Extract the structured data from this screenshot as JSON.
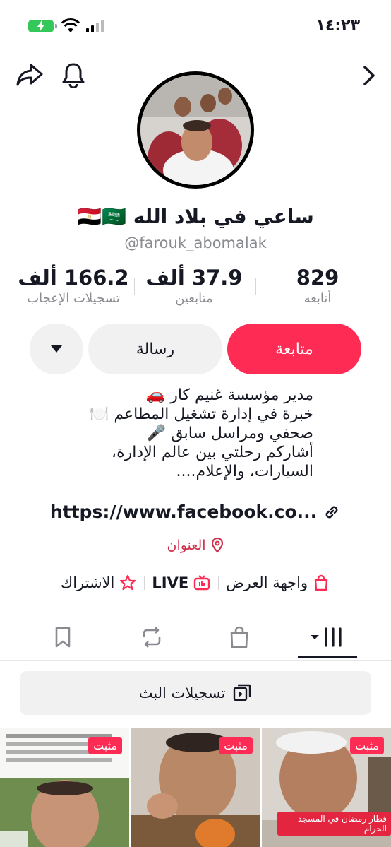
{
  "status": {
    "time": "١٤:٢٣"
  },
  "profile": {
    "name": "ساعي في بلاد الله 🇪🇬🇸🇦",
    "handle": "@farouk_abomalak"
  },
  "stats": [
    {
      "value": "829",
      "label": "أتابعه"
    },
    {
      "value": "37.9 ألف",
      "label": "متابعين"
    },
    {
      "value": "166.2 ألف",
      "label": "تسجيلات الإعجاب"
    }
  ],
  "buttons": {
    "follow": "متابعة",
    "message": "رسالة"
  },
  "bio": {
    "lines": [
      "مدير مؤسسة غنيم كار 🚗",
      "خبرة في إدارة تشغيل المطاعم 🍽️",
      "صحفي ومراسل سابق 🎤",
      "أشاركم رحلتي بين عالم الإدارة،",
      "السيارات، والإعلام...."
    ],
    "link": "https://www.facebook.co..."
  },
  "address": "العنوان",
  "chips": {
    "showcase": "واجهة العرض",
    "live": "LIVE",
    "subscribe": "الاشتراك"
  },
  "live_recordings": "تسجيلات البث",
  "videos": [
    {
      "pinned": "مثبت",
      "caption": ""
    },
    {
      "pinned": "مثبت",
      "caption": ""
    },
    {
      "pinned": "مثبت",
      "caption": "فطار رمضان في المسجد الحرام"
    }
  ],
  "colors": {
    "accent": "#fe2c55",
    "muted": "#8a8b91",
    "battery": "#34c759"
  }
}
